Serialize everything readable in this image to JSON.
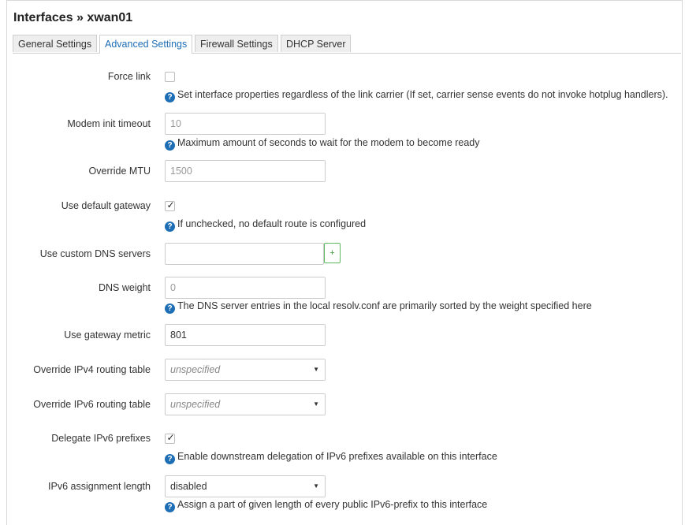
{
  "header": {
    "title": "Interfaces » xwan01"
  },
  "tabs": [
    {
      "label": "General Settings"
    },
    {
      "label": "Advanced Settings",
      "active": true
    },
    {
      "label": "Firewall Settings"
    },
    {
      "label": "DHCP Server"
    }
  ],
  "colors": {
    "accent": "#1e6eb5",
    "add_button": "#5cb85c",
    "border": "#cccccc"
  },
  "fields": {
    "force_link": {
      "label": "Force link",
      "checked": false,
      "help": "Set interface properties regardless of the link carrier (If set, carrier sense events do not invoke hotplug handlers)."
    },
    "modem_init_timeout": {
      "label": "Modem init timeout",
      "placeholder": "10",
      "help": "Maximum amount of seconds to wait for the modem to become ready"
    },
    "override_mtu": {
      "label": "Override MTU",
      "placeholder": "1500"
    },
    "use_default_gateway": {
      "label": "Use default gateway",
      "checked": true,
      "check_glyph": "✓",
      "help": "If unchecked, no default route is configured"
    },
    "custom_dns": {
      "label": "Use custom DNS servers",
      "value": "",
      "add_label": "+"
    },
    "dns_weight": {
      "label": "DNS weight",
      "placeholder": "0",
      "help": "The DNS server entries in the local resolv.conf are primarily sorted by the weight specified here"
    },
    "gateway_metric": {
      "label": "Use gateway metric",
      "value": "801"
    },
    "ipv4_routing_table": {
      "label": "Override IPv4 routing table",
      "selected": "unspecified"
    },
    "ipv6_routing_table": {
      "label": "Override IPv6 routing table",
      "selected": "unspecified"
    },
    "delegate_ipv6": {
      "label": "Delegate IPv6 prefixes",
      "checked": true,
      "check_glyph": "✓",
      "help": "Enable downstream delegation of IPv6 prefixes available on this interface"
    },
    "ipv6_assignment_length": {
      "label": "IPv6 assignment length",
      "selected": "disabled",
      "help": "Assign a part of given length of every public IPv6-prefix to this interface"
    }
  },
  "icons": {
    "help": "question-circle-icon",
    "dropdown": "caret-down-icon",
    "add": "plus-icon"
  },
  "glyphs": {
    "help": "?",
    "dropdown": "▼"
  }
}
